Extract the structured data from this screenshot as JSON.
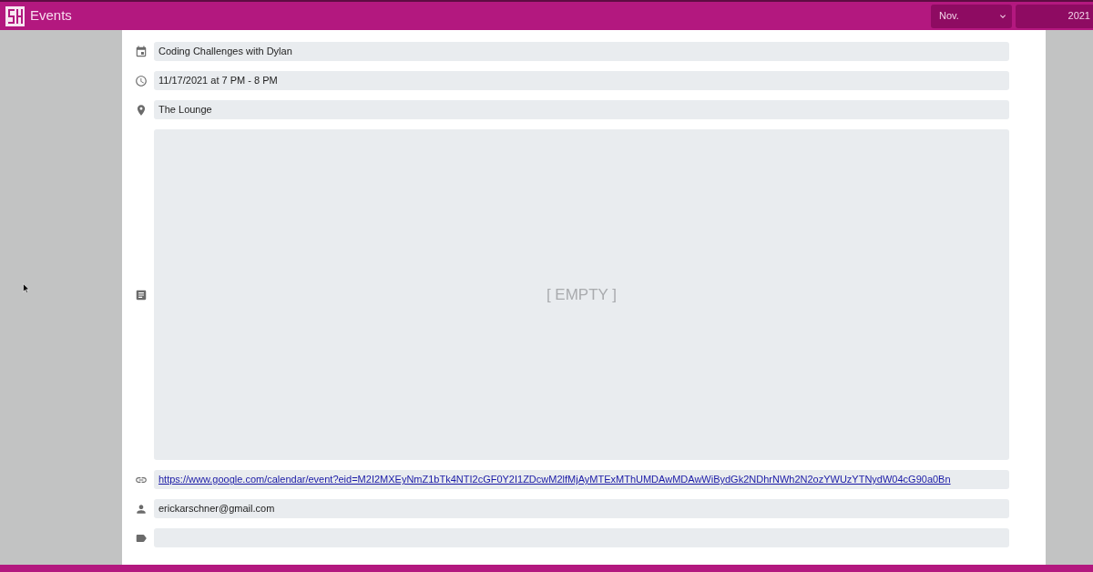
{
  "header": {
    "title": "Events",
    "month_select": {
      "value": "Nov."
    },
    "year_field": {
      "value": "2021"
    }
  },
  "event": {
    "fields": [
      {
        "kind": "title",
        "value": "Coding Challenges with Dylan"
      },
      {
        "kind": "time",
        "value": "11/17/2021 at 7 PM - 8 PM"
      },
      {
        "kind": "location",
        "value": "The Lounge"
      },
      {
        "kind": "description",
        "placeholder": "[ EMPTY ]"
      },
      {
        "kind": "link",
        "value": "https://www.google.com/calendar/event?eid=M2I2MXEyNmZ1bTk4NTI2cGF0Y2I1ZDcwM2lfMjAyMTExMThUMDAwMDAwWiBydGk2NDhrNWh2N2ozYWUzYTNydW04cG90a0Bn"
      },
      {
        "kind": "organizer",
        "value": "erickarschner@gmail.com"
      },
      {
        "kind": "tags"
      }
    ]
  }
}
